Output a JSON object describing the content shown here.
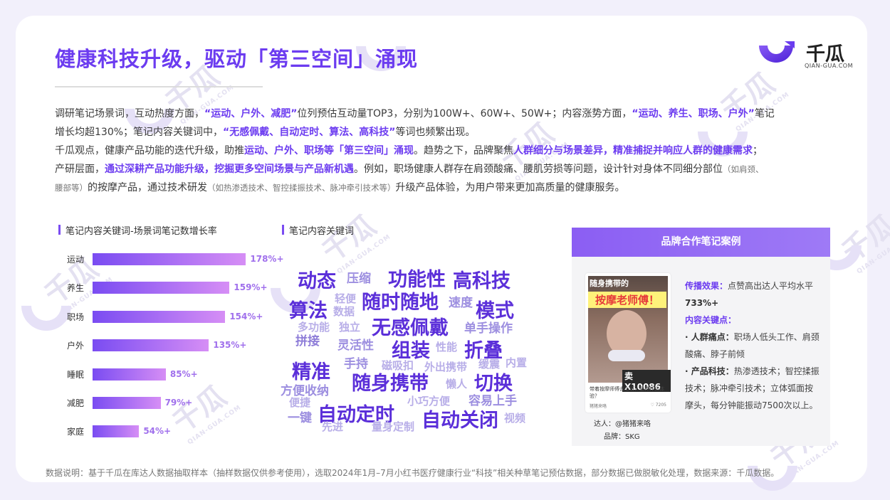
{
  "header": {
    "title": "健康科技升级，驱动「第三空间」涌现",
    "logo_name": "千瓜",
    "logo_sub": "QIAN-GUA.COM"
  },
  "watermark": {
    "text": "千瓜",
    "sub": "QIAN-GUA.COM"
  },
  "paragraph": {
    "l1_a": "调研笔记场景词，互动热度方面，",
    "l1_b": "“运动、户外、减肥”",
    "l1_c": "位列预估互动量TOP3，分别为100W+、60W+、50W+；内容涨势方面，",
    "l1_d": "“运动、养生、职场、户外”",
    "l1_e": "笔记",
    "l2_a": "增长均超130%；笔记内容关键词中，",
    "l2_b": "“无感佩戴、自动定时、算法、高科技”",
    "l2_c": "等词也频繁出现。",
    "l3_a": "千瓜观点，健康产品功能的迭代升级，助推",
    "l3_b": "运动、户外、职场等「第三空间」涌现",
    "l3_c": "。趋势之下，品牌聚焦",
    "l3_d": "人群细分与场景差异，精准捕捉并响应人群的健康需求",
    "l3_e": "；",
    "l4_a": "产研层面，",
    "l4_b": "通过深耕产品功能升级，挖掘更多空间场景与产品新机遇",
    "l4_c": "。例如，职场健康人群存在肩颈酸痛、腰肌劳损等问题，设计针对身体不同细分部位",
    "l4_d": "（如肩颈、",
    "l5_a": "腰部等）",
    "l5_b": "的按摩产品，通过技术研发",
    "l5_c": "（如热渗透技术、智控揉振技术、脉冲牵引技术等）",
    "l5_d": "升级产品体验，为用户带来更加高质量的健康服务。"
  },
  "bar_section": {
    "label": "笔记内容关键词-场景词笔记数增长率"
  },
  "chart_data": {
    "type": "bar",
    "orientation": "horizontal",
    "categories": [
      "运动",
      "养生",
      "职场",
      "户外",
      "睡眠",
      "减肥",
      "家庭"
    ],
    "values": [
      178,
      159,
      154,
      135,
      85,
      79,
      54
    ],
    "value_labels": [
      "178%+",
      "159%+",
      "154%+",
      "135%+",
      "85%+",
      "79%+",
      "54%+"
    ],
    "xlim": [
      0,
      200
    ],
    "colors": {
      "start": "#7a4cf2",
      "end": "#d68ef5",
      "label": "#a070ec"
    }
  },
  "cloud_section": {
    "label": "笔记内容关键词",
    "words": [
      {
        "text": "动态",
        "size": "big"
      },
      {
        "text": "压缩",
        "size": "mid"
      },
      {
        "text": "功能性",
        "size": "big"
      },
      {
        "text": "高科技",
        "size": "big"
      },
      {
        "text": "轻便",
        "size": "sml"
      },
      {
        "text": "随时随地",
        "size": "big"
      },
      {
        "text": "算法",
        "size": "big"
      },
      {
        "text": "数据",
        "size": "sml"
      },
      {
        "text": "速度",
        "size": "mid"
      },
      {
        "text": "模式",
        "size": "big"
      },
      {
        "text": "无感佩戴",
        "size": "big"
      },
      {
        "text": "多功能",
        "size": "sml"
      },
      {
        "text": "独立",
        "size": "sml"
      },
      {
        "text": "单手操作",
        "size": "mid"
      },
      {
        "text": "拼接",
        "size": "mid2"
      },
      {
        "text": "灵活性",
        "size": "mid"
      },
      {
        "text": "组装",
        "size": "big"
      },
      {
        "text": "性能",
        "size": "sml"
      },
      {
        "text": "折叠",
        "size": "big"
      },
      {
        "text": "手持",
        "size": "mid"
      },
      {
        "text": "精准",
        "size": "big"
      },
      {
        "text": "磁吸扣",
        "size": "sml"
      },
      {
        "text": "外出携带",
        "size": "sml"
      },
      {
        "text": "缓震",
        "size": "sml"
      },
      {
        "text": "内置",
        "size": "sml"
      },
      {
        "text": "随身携带",
        "size": "big"
      },
      {
        "text": "切换",
        "size": "big"
      },
      {
        "text": "方便收纳",
        "size": "mid"
      },
      {
        "text": "懒人",
        "size": "sml"
      },
      {
        "text": "便捷",
        "size": "sml"
      },
      {
        "text": "小巧方便",
        "size": "sml"
      },
      {
        "text": "容易上手",
        "size": "mid"
      },
      {
        "text": "自动定时",
        "size": "big"
      },
      {
        "text": "一键",
        "size": "mid"
      },
      {
        "text": "自动关闭",
        "size": "big"
      },
      {
        "text": "视频",
        "size": "sml"
      },
      {
        "text": "先进",
        "size": "sml"
      },
      {
        "text": "量身定制",
        "size": "sml"
      }
    ]
  },
  "case": {
    "header": "品牌合作笔记案例",
    "thumb_top": "随身携带的",
    "thumb_main": "按摩老师傅！",
    "thumb_price": "卖X10086",
    "thumb_caption": "带着按摩师傅去上班，是种什么体验？",
    "thumb_author": "猪猪来咯",
    "thumb_likes": "♡ 7205",
    "influencer": "达人：@猪猪来咯",
    "brand": "品牌：SKG",
    "effect_label": "传播效果：",
    "effect_text": "点赞高出达人平均水平",
    "effect_value": "733%+",
    "keypoints_label": "内容关键点：",
    "pain_label": "· 人群痛点：",
    "pain_text": "职场人低头工作、肩颈酸痛、脖子前倾",
    "tech_label": "· 产品科技：",
    "tech_text": "热渗透技术；智控揉振技术；脉冲牵引技术；立体弧面按摩头，每分钟能振动7500次以上。"
  },
  "footer": {
    "text": "数据说明：基于千瓜在库达人数据抽取样本（抽样数据仅供参考使用），选取2024年1月–7月小红书医疗健康行业“科技”相关种草笔记预估数据，部分数据已做脱敏化处理，数据来源：千瓜数据。"
  }
}
